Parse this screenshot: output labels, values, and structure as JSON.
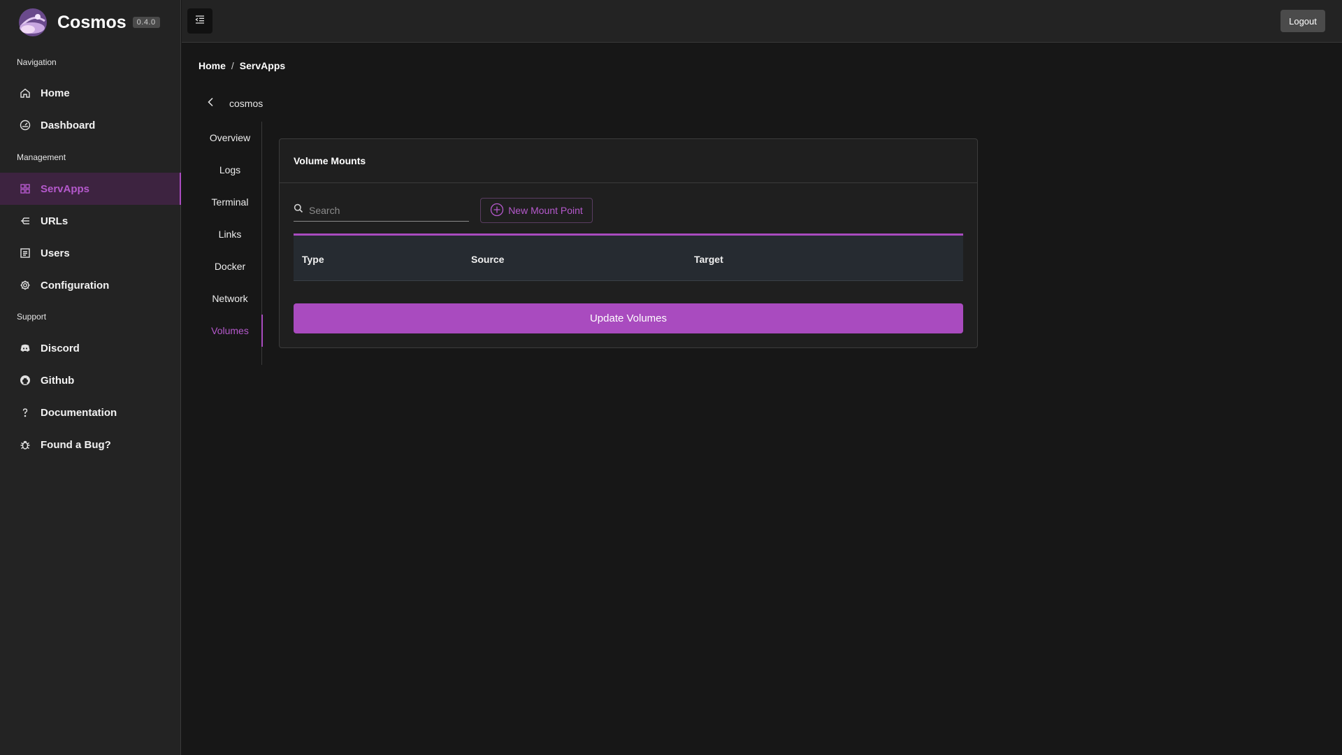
{
  "brand": {
    "name": "Cosmos",
    "version": "0.4.0"
  },
  "sidebar": {
    "sections": {
      "navigation": "Navigation",
      "management": "Management",
      "support": "Support"
    },
    "items": [
      {
        "label": "Home",
        "icon": "home-icon"
      },
      {
        "label": "Dashboard",
        "icon": "dashboard-icon"
      },
      {
        "label": "ServApps",
        "icon": "grid-icon",
        "active": true
      },
      {
        "label": "URLs",
        "icon": "routes-icon"
      },
      {
        "label": "Users",
        "icon": "users-icon"
      },
      {
        "label": "Configuration",
        "icon": "gear-icon"
      },
      {
        "label": "Discord",
        "icon": "discord-icon"
      },
      {
        "label": "Github",
        "icon": "github-icon"
      },
      {
        "label": "Documentation",
        "icon": "question-icon"
      },
      {
        "label": "Found a Bug?",
        "icon": "bug-icon"
      }
    ]
  },
  "header": {
    "logout_label": "Logout"
  },
  "breadcrumb": {
    "home": "Home",
    "separator": "/",
    "current": "ServApps"
  },
  "app": {
    "name": "cosmos"
  },
  "tabs": [
    {
      "label": "Overview"
    },
    {
      "label": "Logs"
    },
    {
      "label": "Terminal"
    },
    {
      "label": "Links"
    },
    {
      "label": "Docker"
    },
    {
      "label": "Network"
    },
    {
      "label": "Volumes",
      "active": true
    }
  ],
  "volumes": {
    "title": "Volume Mounts",
    "search_placeholder": "Search",
    "new_mount_label": "New Mount Point",
    "columns": [
      "Type",
      "Source",
      "Target"
    ],
    "rows": [],
    "update_label": "Update Volumes"
  },
  "colors": {
    "accent": "#a94bbf",
    "background": "#171717",
    "sidebar": "#232323"
  }
}
